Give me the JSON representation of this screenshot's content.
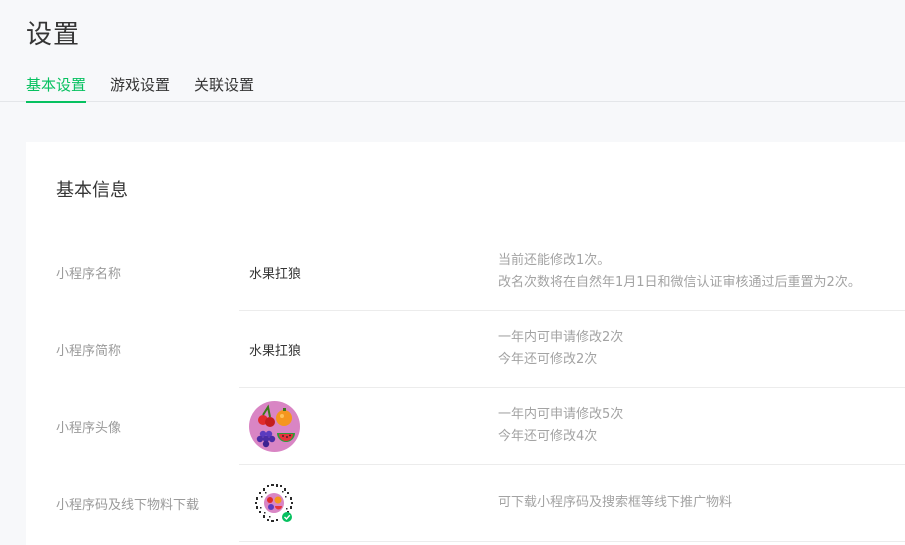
{
  "page": {
    "title": "设置"
  },
  "tabs": [
    {
      "label": "基本设置",
      "active": true
    },
    {
      "label": "游戏设置",
      "active": false
    },
    {
      "label": "关联设置",
      "active": false
    }
  ],
  "colors": {
    "accent": "#07c160",
    "avatar_bg": "#d985c4"
  },
  "basic_info": {
    "title": "基本信息",
    "rows": [
      {
        "label": "小程序名称",
        "value": "水果扛狼",
        "desc": [
          "当前还能修改1次。",
          "改名次数将在自然年1月1日和微信认证审核通过后重置为2次。"
        ]
      },
      {
        "label": "小程序简称",
        "value": "水果扛狼",
        "desc": [
          "一年内可申请修改2次",
          "今年还可修改2次"
        ]
      },
      {
        "label": "小程序头像",
        "image": "fruit-avatar-icon",
        "desc": [
          "一年内可申请修改5次",
          "今年还可修改4次"
        ]
      },
      {
        "label": "小程序码及线下物料下载",
        "image": "mini-program-code-icon",
        "desc": [
          "可下载小程序码及搜索框等线下推广物料"
        ]
      }
    ]
  }
}
